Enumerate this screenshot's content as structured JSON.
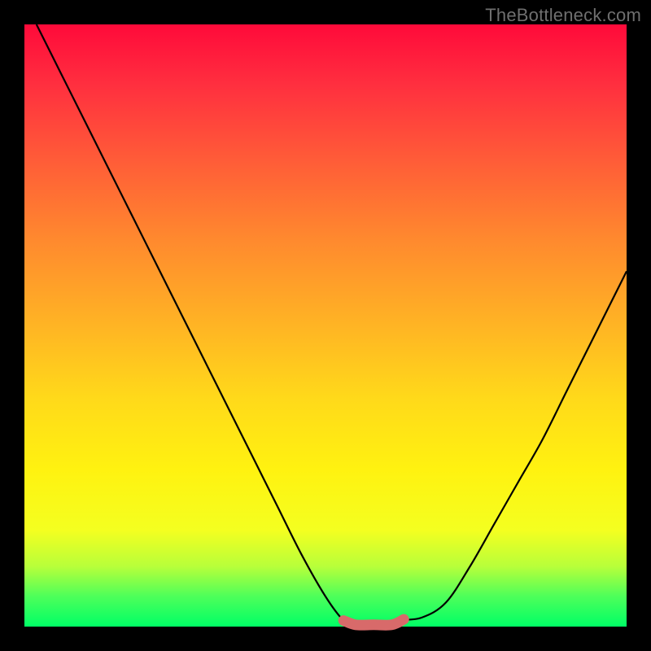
{
  "watermark": "TheBottleneck.com",
  "chart_data": {
    "type": "line",
    "title": "",
    "xlabel": "",
    "ylabel": "",
    "xlim": [
      0,
      100
    ],
    "ylim": [
      0,
      100
    ],
    "series": [
      {
        "name": "bottleneck-curve",
        "x": [
          2,
          6,
          10,
          14,
          18,
          22,
          26,
          30,
          34,
          38,
          42,
          46,
          50,
          53,
          55,
          58,
          62,
          66,
          70,
          74,
          78,
          82,
          86,
          90,
          94,
          98,
          100
        ],
        "values": [
          100,
          92,
          84,
          76,
          68,
          60,
          52,
          44,
          36,
          28,
          20,
          12,
          5,
          1,
          0,
          0,
          1,
          1.5,
          4,
          10,
          17,
          24,
          31,
          39,
          47,
          55,
          59
        ]
      },
      {
        "name": "flat-bottom-marker",
        "x": [
          53,
          55,
          58,
          61,
          63
        ],
        "values": [
          1,
          0.3,
          0.3,
          0.3,
          1.2
        ]
      }
    ],
    "gradient_stops": [
      {
        "pos": 0,
        "color": "#ff0a3a"
      },
      {
        "pos": 10,
        "color": "#ff2f3f"
      },
      {
        "pos": 22,
        "color": "#ff5a38"
      },
      {
        "pos": 36,
        "color": "#ff8a2e"
      },
      {
        "pos": 50,
        "color": "#ffb424"
      },
      {
        "pos": 62,
        "color": "#ffd91a"
      },
      {
        "pos": 74,
        "color": "#fff210"
      },
      {
        "pos": 84,
        "color": "#f4ff20"
      },
      {
        "pos": 90,
        "color": "#b8ff3a"
      },
      {
        "pos": 95,
        "color": "#4dff5a"
      },
      {
        "pos": 100,
        "color": "#00ff66"
      }
    ],
    "colors": {
      "curve": "#000000",
      "marker": "#d86a6a",
      "background_frame": "#000000"
    }
  }
}
